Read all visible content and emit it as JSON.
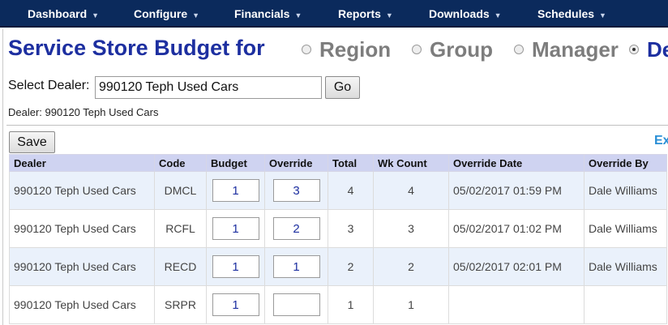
{
  "nav": [
    {
      "label": "Dashboard"
    },
    {
      "label": "Configure"
    },
    {
      "label": "Financials"
    },
    {
      "label": "Reports"
    },
    {
      "label": "Downloads"
    },
    {
      "label": "Schedules"
    }
  ],
  "page": {
    "title": "Service Store Budget for",
    "scopes": [
      {
        "label": "Region",
        "checked": false
      },
      {
        "label": "Group",
        "checked": false
      },
      {
        "label": "Manager",
        "checked": false
      },
      {
        "label": "De",
        "checked": true
      }
    ]
  },
  "dealer_select": {
    "label": "Select Dealer:",
    "value": "990120 Teph Used Cars",
    "go_label": "Go",
    "current_line": "Dealer: 990120 Teph Used Cars"
  },
  "toolbar": {
    "save_label": "Save",
    "export_label": "Ex"
  },
  "table": {
    "headers": [
      "Dealer",
      "Code",
      "Budget",
      "Override",
      "Total",
      "Wk Count",
      "Override Date",
      "Override By"
    ],
    "rows": [
      {
        "dealer": "990120 Teph Used Cars",
        "code": "DMCL",
        "budget": "1",
        "override": "3",
        "total": "4",
        "wk_count": "4",
        "override_date": "05/02/2017 01:59 PM",
        "override_by": "Dale Williams"
      },
      {
        "dealer": "990120 Teph Used Cars",
        "code": "RCFL",
        "budget": "1",
        "override": "2",
        "total": "3",
        "wk_count": "3",
        "override_date": "05/02/2017 01:02 PM",
        "override_by": "Dale Williams"
      },
      {
        "dealer": "990120 Teph Used Cars",
        "code": "RECD",
        "budget": "1",
        "override": "1",
        "total": "2",
        "wk_count": "2",
        "override_date": "05/02/2017 02:01 PM",
        "override_by": "Dale Williams"
      },
      {
        "dealer": "990120 Teph Used Cars",
        "code": "SRPR",
        "budget": "1",
        "override": "",
        "total": "1",
        "wk_count": "1",
        "override_date": "",
        "override_by": ""
      }
    ]
  },
  "colors": {
    "nav_bg": "#0b2a5c",
    "title_blue": "#1d2fa0",
    "header_bg": "#cfd3f1",
    "alt_row_bg": "#eaf1fb",
    "link_blue": "#2a8fd6"
  }
}
